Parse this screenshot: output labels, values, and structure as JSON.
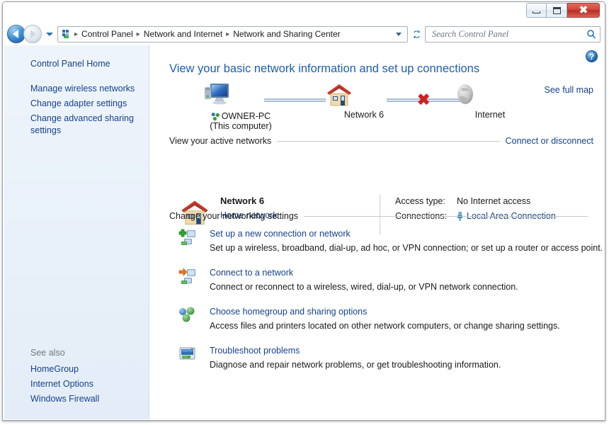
{
  "window": {
    "minimize_label": "Minimize",
    "maximize_label": "Maximize",
    "close_label": "Close"
  },
  "navigation": {
    "back_label": "Back",
    "forward_label": "Forward",
    "recent_pages_label": "Recent pages",
    "refresh_label": "Refresh",
    "breadcrumb": [
      "Control Panel",
      "Network and Internet",
      "Network and Sharing Center"
    ],
    "separator": "▸"
  },
  "search": {
    "placeholder": "Search Control Panel",
    "value": "",
    "icon": "search-icon"
  },
  "sidebar": {
    "home_label": "Control Panel Home",
    "tasks": [
      "Manage wireless networks",
      "Change adapter settings",
      "Change advanced sharing settings"
    ],
    "see_also_title": "See also",
    "see_also": [
      "HomeGroup",
      "Internet Options",
      "Windows Firewall"
    ]
  },
  "content": {
    "help_label": "?",
    "heading": "View your basic network information and set up connections",
    "see_full_map": "See full map",
    "network_map": {
      "computer_label": "OWNER-PC",
      "computer_sublabel": "(This computer)",
      "network_label": "Network  6",
      "internet_label": "Internet",
      "link_broken": "✖"
    },
    "active_networks": {
      "header": "View your active networks",
      "header_link": "Connect or disconnect",
      "network_name": "Network  6",
      "network_type": "Home network",
      "access_type_label": "Access type:",
      "access_type_value": "No Internet access",
      "connections_label": "Connections:",
      "connections_value": "Local Area Connection"
    },
    "settings": {
      "header": "Change your networking settings",
      "items": [
        {
          "icon": "add-connection-icon",
          "title": "Set up a new connection or network",
          "desc": "Set up a wireless, broadband, dial-up, ad hoc, or VPN connection; or set up a router or access point."
        },
        {
          "icon": "connect-network-icon",
          "title": "Connect to a network",
          "desc": "Connect or reconnect to a wireless, wired, dial-up, or VPN network connection."
        },
        {
          "icon": "homegroup-icon",
          "title": "Choose homegroup and sharing options",
          "desc": "Access files and printers located on other network computers, or change sharing settings."
        },
        {
          "icon": "troubleshoot-icon",
          "title": "Troubleshoot problems",
          "desc": "Diagnose and repair network problems, or get troubleshooting information."
        }
      ]
    }
  },
  "colors": {
    "link": "#15428b",
    "heading": "#1c5fae",
    "sidebar_bg": "#e8f0f9",
    "close_button": "#c0392b",
    "error_x": "#cc2222"
  }
}
